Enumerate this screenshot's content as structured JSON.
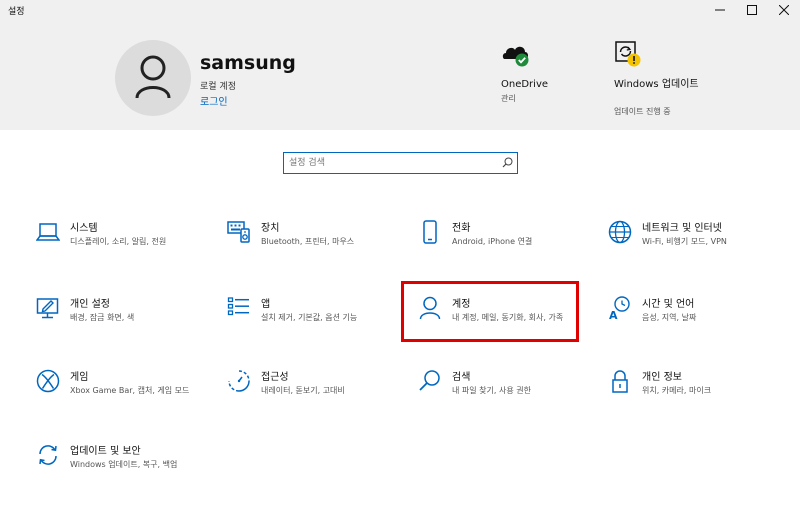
{
  "app": {
    "title": "설정"
  },
  "window_controls": {
    "minimize": "—",
    "maximize": "☐",
    "close": "✕"
  },
  "user": {
    "name": "samsung",
    "account_type": "로컬 계정",
    "login_link": "로그인"
  },
  "header_items": [
    {
      "title": "OneDrive",
      "subtitle": "관리",
      "icon": "onedrive-icon"
    },
    {
      "title": "Windows 업데이트",
      "subtitle": "업데이트 진행 중",
      "icon": "windows-update-icon"
    }
  ],
  "search": {
    "placeholder": "설정 검색",
    "icon": "search-icon"
  },
  "categories": [
    {
      "title": "시스템",
      "subtitle": "디스플레이, 소리, 알림, 전원",
      "icon": "laptop-icon"
    },
    {
      "title": "장치",
      "subtitle": "Bluetooth, 프린터, 마우스",
      "icon": "devices-icon"
    },
    {
      "title": "전화",
      "subtitle": "Android, iPhone 연결",
      "icon": "phone-icon"
    },
    {
      "title": "네트워크 및 인터넷",
      "subtitle": "Wi-Fi, 비행기 모드, VPN",
      "icon": "globe-icon"
    },
    {
      "title": "개인 설정",
      "subtitle": "배경, 잠금 화면, 색",
      "icon": "personalization-icon"
    },
    {
      "title": "앱",
      "subtitle": "설치 제거, 기본값, 옵션 기능",
      "icon": "apps-list-icon"
    },
    {
      "title": "계정",
      "subtitle": "내 계정, 메일, 동기화, 회사, 가족",
      "icon": "person-icon"
    },
    {
      "title": "시간 및 언어",
      "subtitle": "음성, 지역, 날짜",
      "icon": "time-language-icon"
    },
    {
      "title": "게임",
      "subtitle": "Xbox Game Bar, 캡처, 게임 모드",
      "icon": "xbox-icon"
    },
    {
      "title": "접근성",
      "subtitle": "내레이터, 돋보기, 고대비",
      "icon": "ease-of-access-icon"
    },
    {
      "title": "검색",
      "subtitle": "내 파일 찾기, 사용 권한",
      "icon": "search-icon"
    },
    {
      "title": "개인 정보",
      "subtitle": "위치, 카메라, 마이크",
      "icon": "lock-icon"
    },
    {
      "title": "업데이트 및 보안",
      "subtitle": "Windows 업데이트, 복구, 백업",
      "icon": "sync-icon"
    }
  ],
  "colors": {
    "accent": "#0067c0",
    "header_bg": "#f0f0f0",
    "highlight": "#e10000",
    "success": "#1e8a3a",
    "warning": "#f5c400"
  }
}
